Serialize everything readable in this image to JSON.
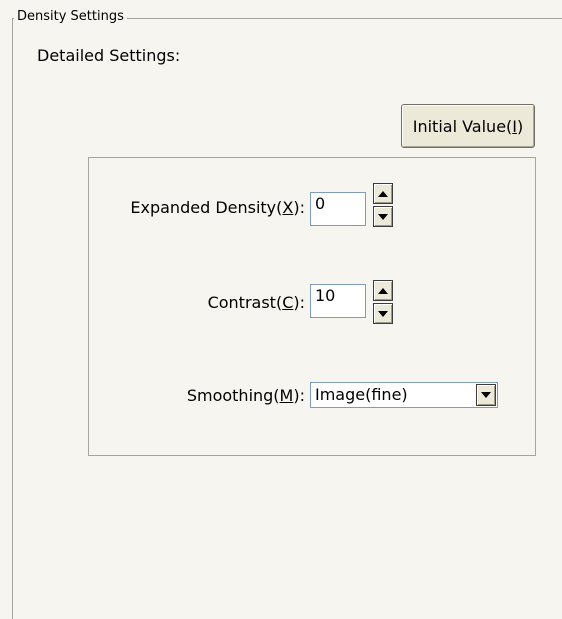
{
  "group": {
    "legend": "Density Settings"
  },
  "detailed_label": "Detailed Settings:",
  "initial_button": {
    "prefix": "Initial Value(",
    "mnemonic": "I",
    "suffix": ")"
  },
  "expanded_density": {
    "prefix": "Expanded Density(",
    "mnemonic": "X",
    "suffix": "):",
    "value": "0"
  },
  "contrast": {
    "prefix": "Contrast(",
    "mnemonic": "C",
    "suffix": "):",
    "value": "10"
  },
  "smoothing": {
    "prefix": "Smoothing(",
    "mnemonic": "M",
    "suffix": "):",
    "selected": "Image(fine)"
  },
  "icons": {
    "spin_up": "triangle-up",
    "spin_down": "triangle-down",
    "dropdown": "triangle-down"
  }
}
